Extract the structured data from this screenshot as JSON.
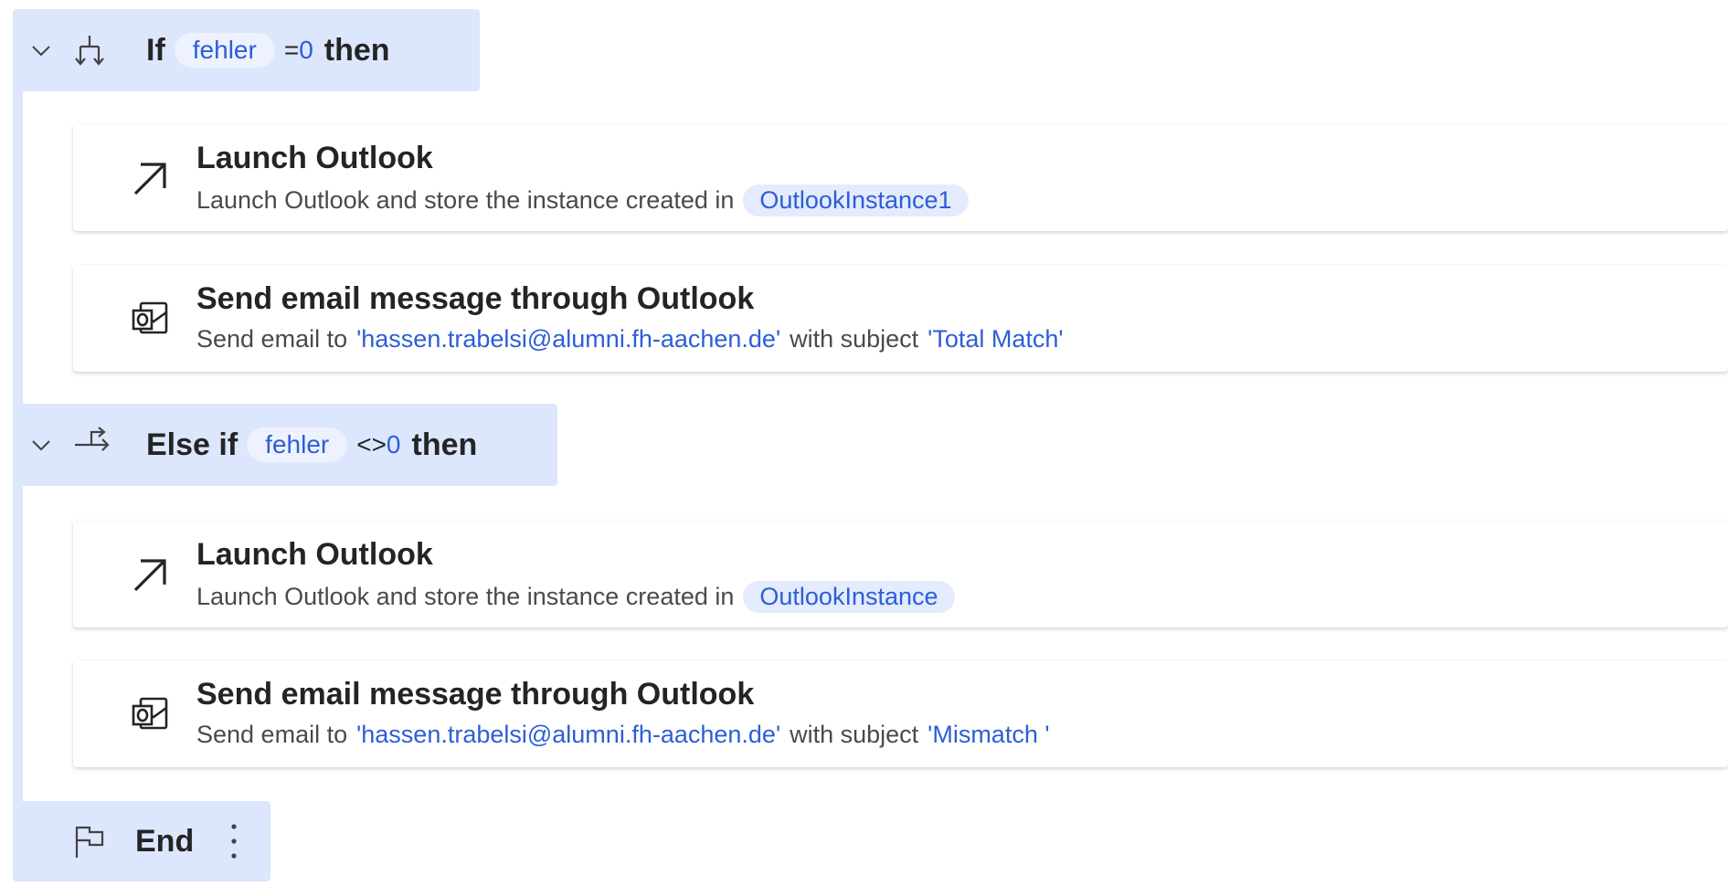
{
  "icons": {
    "chevron": "chevron-down-icon",
    "if": "if-branch-icon",
    "else_if": "else-if-branch-icon",
    "launch": "arrow-up-right-icon",
    "outlook": "outlook-mail-icon",
    "end": "flag-icon",
    "more": "more-vertical-icon"
  },
  "if_block": {
    "keyword": "If",
    "variable": "fehler",
    "operator": "=",
    "value": "0",
    "then": "then"
  },
  "if_actions": [
    {
      "title": "Launch Outlook",
      "desc_prefix": "Launch Outlook and store the instance created in",
      "variable": "OutlookInstance1"
    },
    {
      "title": "Send email message through Outlook",
      "desc_prefix": "Send email to",
      "recipient": "'hassen.trabelsi@alumni.fh-aachen.de'",
      "desc_middle": "with subject",
      "subject": "'Total Match'"
    }
  ],
  "else_if_block": {
    "keyword": "Else if",
    "variable": "fehler",
    "operator": "<>",
    "value": "0",
    "then": "then"
  },
  "else_if_actions": [
    {
      "title": "Launch Outlook",
      "desc_prefix": "Launch Outlook and store the instance created in",
      "variable": "OutlookInstance"
    },
    {
      "title": "Send email message through Outlook",
      "desc_prefix": "Send email to",
      "recipient": "'hassen.trabelsi@alumni.fh-aachen.de'",
      "desc_middle": "with subject",
      "subject": "'Mismatch '"
    }
  ],
  "end_block": {
    "label": "End"
  },
  "colors": {
    "header_bg": "#dce6fc",
    "variable_pill_bg": "#e3ebfd",
    "accent": "#2d5ed6",
    "text": "#242424"
  }
}
